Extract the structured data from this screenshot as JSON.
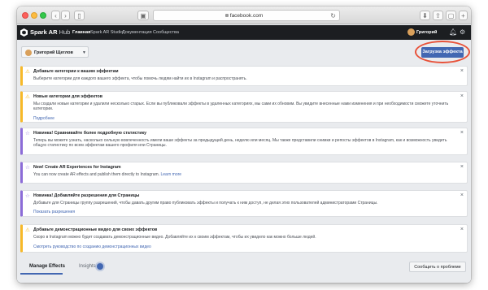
{
  "browser": {
    "address": "facebook.com",
    "icons": {
      "back": "chevron-left-icon",
      "forward": "chevron-right-icon",
      "sidebar": "sidebar-icon",
      "lock": "lock-icon",
      "reload": "reload-icon",
      "download": "download-icon",
      "share": "share-icon",
      "new_tab": "new-tab-icon",
      "tab_overview": "tab-overview-icon",
      "tab_switch": "tab-switch-icon"
    }
  },
  "header": {
    "brand": "Spark AR",
    "brand_suffix": "Hub",
    "nav": [
      "Главная",
      "Spark AR Studio",
      "Документация",
      "Сообщества"
    ],
    "user_name": "Григорий",
    "icons": [
      "bell-icon",
      "gear-icon"
    ]
  },
  "toolbar": {
    "user_select": "Григорий Щеглов",
    "upload_button": "Загрузка эффекта"
  },
  "notices": [
    {
      "type": "warning",
      "icon": "warning-icon",
      "title": "Добавьте категории к вашим эффектам",
      "body": "Выберите категории для каждого вашего эффекта, чтобы помочь людям найти их в Instagram и распространять.",
      "link": ""
    },
    {
      "type": "warning",
      "icon": "warning-icon",
      "title": "Новые категории для эффектов",
      "body": "Мы создали новые категории и удалили несколько старых. Если вы публиковали эффекты в удаленных категориях, мы сами их обновим. Вы увидите внесенные нами изменения и при необходимости сможете уточнить категории.",
      "link": "Подробнее"
    },
    {
      "type": "new",
      "icon": "star-icon",
      "title": "Новинка! Сравнивайте более подробную статистику",
      "body": "Теперь вы можете узнать, насколько сильную вовлеченность имели ваши эффекты за предыдущий день, неделю или месяц. Мы также представили снимки и репосты эффектов в Instagram, как и возможность увидеть общую статистику по всем эффектам вашего профиля или Страницы.",
      "link": ""
    },
    {
      "type": "new",
      "icon": "star-icon",
      "title": "New! Create AR Experiences for Instagram",
      "body": "You can now create AR effects and publish them directly to Instagram.",
      "link": "Learn more"
    },
    {
      "type": "new",
      "icon": "star-icon",
      "title": "Новинка! Добавляйте разрешения для Страницы",
      "body": "Добавьте для Страницы группу разрешений, чтобы давать другим право публиковать эффекты и получать к ним доступ, не делая этих пользователей администраторами Страницы.",
      "link": "Показать разрешения"
    },
    {
      "type": "warning",
      "icon": "warning-icon",
      "title": "Добавьте демонстрационные видео для своих эффектов",
      "body": "Скоро в Instagram можно будет создавать демонстрационные видео. Добавляйте их к своим эффектам, чтобы их увидело как можно больше людей.",
      "link": "Смотреть руководство по созданию демонстрационных видео"
    }
  ],
  "tabs": [
    "Manage Effects",
    "Insights"
  ],
  "footer": {
    "report_button": "Сообщить о проблеме"
  },
  "colors": {
    "accent": "#4267b2",
    "warning": "#f7b928",
    "new": "#8c6cd8",
    "highlight": "#e8523a",
    "header_bg": "#1c1e21"
  }
}
